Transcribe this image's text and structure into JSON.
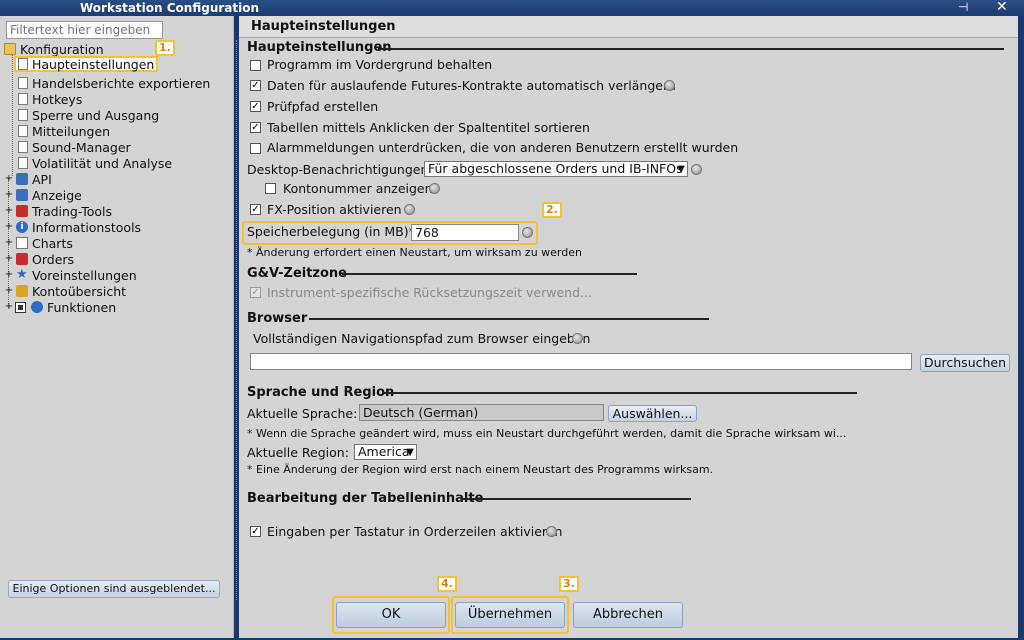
{
  "window": {
    "title": "Workstation Configuration",
    "pin_glyph": "⊣",
    "close_glyph": "✕"
  },
  "sidebar": {
    "filter_placeholder": "Filtertext hier eingeben",
    "root": "Konfiguration",
    "children": [
      "Haupteinstellungen",
      "Handelsberichte exportieren",
      "Hotkeys",
      "Sperre und Ausgang",
      "Mitteilungen",
      "Sound-Manager",
      "Volatilität und Analyse"
    ],
    "groups": [
      "API",
      "Anzeige",
      "Trading-Tools",
      "Informationstools",
      "Charts",
      "Orders",
      "Voreinstellungen",
      "Kontoübersicht",
      "Funktionen"
    ],
    "hidden_options_label": "Einige Optionen sind ausgeblendet..."
  },
  "callouts": [
    "1.",
    "2.",
    "3.",
    "4."
  ],
  "main": {
    "header": "Haupteinstellungen",
    "general": {
      "title": "Haupteinstellungen",
      "items": [
        {
          "label": "Programm im Vordergrund behalten",
          "checked": false
        },
        {
          "label": "Daten für auslaufende Futures-Kontrakte automatisch verlängern",
          "checked": true
        },
        {
          "label": "Prüfpfad erstellen",
          "checked": true
        },
        {
          "label": "Tabellen mittels Anklicken der Spaltentitel sortieren",
          "checked": true
        },
        {
          "label": "Alarmmeldungen unterdrücken, die von anderen Benutzern erstellt wurden",
          "checked": false
        }
      ],
      "desktop_label": "Desktop-Benachrichtigungen",
      "desktop_value": "Für abgeschlossene Orders und IB-INFOs",
      "account_label": "Kontonummer anzeigen",
      "fx_label": "FX-Position aktivieren",
      "memory_label": "Speicherbelegung (in MB)*",
      "memory_value": "768",
      "memory_note": "* Änderung erfordert einen Neustart, um wirksam zu werden"
    },
    "timezone": {
      "title": "G&V-Zeitzone",
      "item": "Instrument-spezifische Rücksetzungszeit verwend..."
    },
    "browser": {
      "title": "Browser",
      "label": "Vollständigen Navigationspfad zum Browser eingeben",
      "path_value": "",
      "browse_button": "Durchsuchen"
    },
    "language": {
      "title": "Sprache und Region",
      "current_language_label": "Aktuelle Sprache:",
      "current_language_value": "Deutsch (German)",
      "select_button": "Auswählen...",
      "language_note": "* Wenn die Sprache geändert wird, muss ein Neustart durchgeführt werden, damit die Sprache wirksam wi...",
      "region_label": "Aktuelle Region:",
      "region_value": "America",
      "region_note": "* Eine Änderung der Region wird erst nach einem Neustart des Programms wirksam."
    },
    "table_edit": {
      "title": "Bearbeitung der Tabelleninhalte",
      "item": "Eingaben per Tastatur in Orderzeilen aktivieren"
    }
  },
  "buttons": {
    "ok": "OK",
    "apply": "Übernehmen",
    "cancel": "Abbrechen"
  }
}
